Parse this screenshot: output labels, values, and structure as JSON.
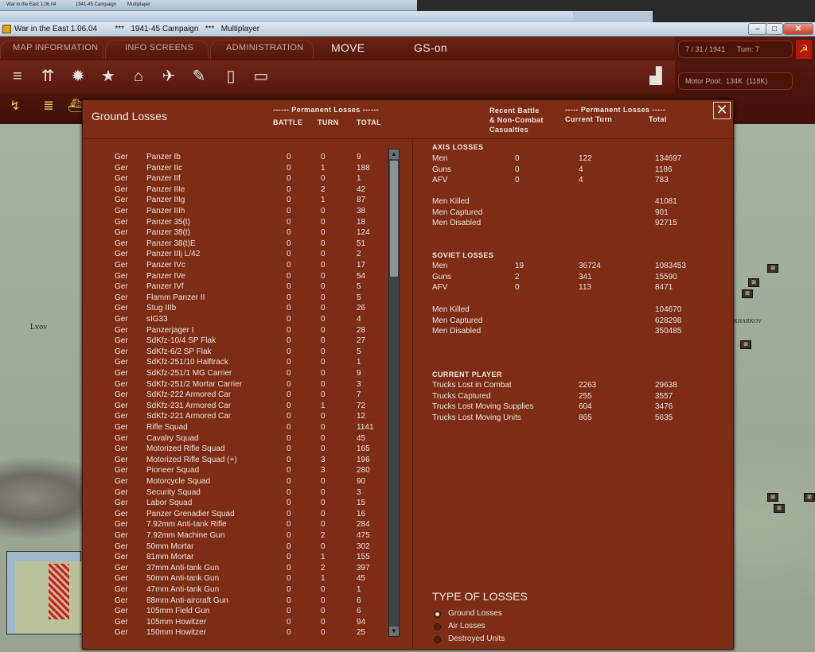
{
  "os": {
    "bg_tab1": "War in the East 1.06.04",
    "bg_tab2": "1941-45 Campaign",
    "bg_tab3": "Multiplayer",
    "window_title": "War in the East 1.06.04        ***   1941-45 Campaign   ***   Multiplayer",
    "btn_min": "–",
    "btn_max": "□",
    "btn_close": "✕"
  },
  "game": {
    "menu": [
      "MAP INFORMATION",
      "INFO SCREENS",
      "ADMINISTRATION",
      "MOVE",
      "GS-on"
    ],
    "date_turn": "7 / 31 / 1941      Turn: 7",
    "motor_pool": "Motor Pool:  134K  (118K)"
  },
  "map": {
    "city_lvov": "Lvov",
    "city_kharkov": "KHARKOV"
  },
  "dialog": {
    "title": "Ground Losses",
    "close": "✕",
    "left_group_header": "------ Permanent Losses ------",
    "col_battle": "BATTLE",
    "col_turn": "TURN",
    "col_total": "TOTAL",
    "right_h1": "Recent Battle\n& Non-Combat\nCasualties",
    "right_h2": "----- Permanent Losses -----",
    "right_h2a": "Current Turn",
    "right_h2b": "Total"
  },
  "losses": [
    [
      "Ger",
      "Panzer Ib",
      "0",
      "0",
      "9"
    ],
    [
      "Ger",
      "Panzer IIc",
      "0",
      "1",
      "188"
    ],
    [
      "Ger",
      "Panzer IIf",
      "0",
      "0",
      "1"
    ],
    [
      "Ger",
      "Panzer IIIe",
      "0",
      "2",
      "42"
    ],
    [
      "Ger",
      "Panzer IIIg",
      "0",
      "1",
      "87"
    ],
    [
      "Ger",
      "Panzer IIIh",
      "0",
      "0",
      "38"
    ],
    [
      "Ger",
      "Panzer 35(t)",
      "0",
      "0",
      "18"
    ],
    [
      "Ger",
      "Panzer 38(t)",
      "0",
      "0",
      "124"
    ],
    [
      "Ger",
      "Panzer 38(t)E",
      "0",
      "0",
      "51"
    ],
    [
      "Ger",
      "Panzer IIIj L/42",
      "0",
      "0",
      "2"
    ],
    [
      "Ger",
      "Panzer IVc",
      "0",
      "0",
      "17"
    ],
    [
      "Ger",
      "Panzer IVe",
      "0",
      "0",
      "54"
    ],
    [
      "Ger",
      "Panzer IVf",
      "0",
      "0",
      "5"
    ],
    [
      "Ger",
      "Flamm Panzer II",
      "0",
      "0",
      "5"
    ],
    [
      "Ger",
      "Stug IIIb",
      "0",
      "0",
      "26"
    ],
    [
      "Ger",
      "sIG33",
      "0",
      "0",
      "4"
    ],
    [
      "Ger",
      "Panzerjager I",
      "0",
      "0",
      "28"
    ],
    [
      "Ger",
      "SdKfz-10/4 SP Flak",
      "0",
      "0",
      "27"
    ],
    [
      "Ger",
      "SdKfz-6/2 SP Flak",
      "0",
      "0",
      "5"
    ],
    [
      "Ger",
      "SdKfz-251/10 Halftrack",
      "0",
      "0",
      "1"
    ],
    [
      "Ger",
      "SdKfz-251/1 MG Carrier",
      "0",
      "0",
      "9"
    ],
    [
      "Ger",
      "SdKfz-251/2 Mortar Carrier",
      "0",
      "0",
      "3"
    ],
    [
      "Ger",
      "SdKfz-222 Armored Car",
      "0",
      "0",
      "7"
    ],
    [
      "Ger",
      "SdKfz-231 Armored Car",
      "0",
      "1",
      "72"
    ],
    [
      "Ger",
      "SdKfz-221 Armored Car",
      "0",
      "0",
      "12"
    ],
    [
      "Ger",
      "Rifle Squad",
      "0",
      "0",
      "1141"
    ],
    [
      "Ger",
      "Cavalry Squad",
      "0",
      "0",
      "45"
    ],
    [
      "Ger",
      "Motorized Rifle Squad",
      "0",
      "0",
      "165"
    ],
    [
      "Ger",
      "Motorized Rifle Squad (+)",
      "0",
      "3",
      "196"
    ],
    [
      "Ger",
      "Pioneer Squad",
      "0",
      "3",
      "280"
    ],
    [
      "Ger",
      "Motorcycle Squad",
      "0",
      "0",
      "90"
    ],
    [
      "Ger",
      "Security Squad",
      "0",
      "0",
      "3"
    ],
    [
      "Ger",
      "Labor Squad",
      "0",
      "0",
      "15"
    ],
    [
      "Ger",
      "Panzer Grenadier Squad",
      "0",
      "0",
      "16"
    ],
    [
      "Ger",
      "7.92mm Anti-tank Rifle",
      "0",
      "0",
      "284"
    ],
    [
      "Ger",
      "7.92mm Machine Gun",
      "0",
      "2",
      "475"
    ],
    [
      "Ger",
      "50mm Mortar",
      "0",
      "0",
      "302"
    ],
    [
      "Ger",
      "81mm Mortar",
      "0",
      "1",
      "155"
    ],
    [
      "Ger",
      "37mm Anti-tank Gun",
      "0",
      "2",
      "397"
    ],
    [
      "Ger",
      "50mm Anti-tank Gun",
      "0",
      "1",
      "45"
    ],
    [
      "Ger",
      "47mm Anti-tank Gun",
      "0",
      "0",
      "1"
    ],
    [
      "Ger",
      "88mm Anti-aircraft Gun",
      "0",
      "0",
      "6"
    ],
    [
      "Ger",
      "105mm Field Gun",
      "0",
      "0",
      "6"
    ],
    [
      "Ger",
      "105mm Howitzer",
      "0",
      "0",
      "94"
    ],
    [
      "Ger",
      "150mm Howitzer",
      "0",
      "0",
      "25"
    ]
  ],
  "axis": {
    "title": "AXIS LOSSES",
    "rows": [
      [
        "Men",
        "0",
        "122",
        "134697"
      ],
      [
        "Guns",
        "0",
        "4",
        "1186"
      ],
      [
        "AFV",
        "0",
        "4",
        "783"
      ]
    ],
    "detail": [
      [
        "Men Killed",
        "41081"
      ],
      [
        "Men Captured",
        "901"
      ],
      [
        "Men Disabled",
        "92715"
      ]
    ]
  },
  "soviet": {
    "title": "SOVIET LOSSES",
    "rows": [
      [
        "Men",
        "19",
        "36724",
        "1083453"
      ],
      [
        "Guns",
        "2",
        "341",
        "15590"
      ],
      [
        "AFV",
        "0",
        "113",
        "8471"
      ]
    ],
    "detail": [
      [
        "Men Killed",
        "104670"
      ],
      [
        "Men Captured",
        "628298"
      ],
      [
        "Men Disabled",
        "350485"
      ]
    ]
  },
  "player": {
    "title": "CURRENT PLAYER",
    "rows": [
      [
        "Trucks Lost in Combat",
        "2263",
        "29638"
      ],
      [
        "Trucks Captured",
        "255",
        "3557"
      ],
      [
        "Trucks Lost Moving Supplies",
        "604",
        "3476"
      ],
      [
        "Trucks Lost Moving Units",
        "865",
        "5635"
      ]
    ]
  },
  "type": {
    "title": "TYPE OF LOSSES",
    "options": [
      "Ground Losses",
      "Air Losses",
      "Destroyed Units"
    ],
    "selected": 0
  }
}
